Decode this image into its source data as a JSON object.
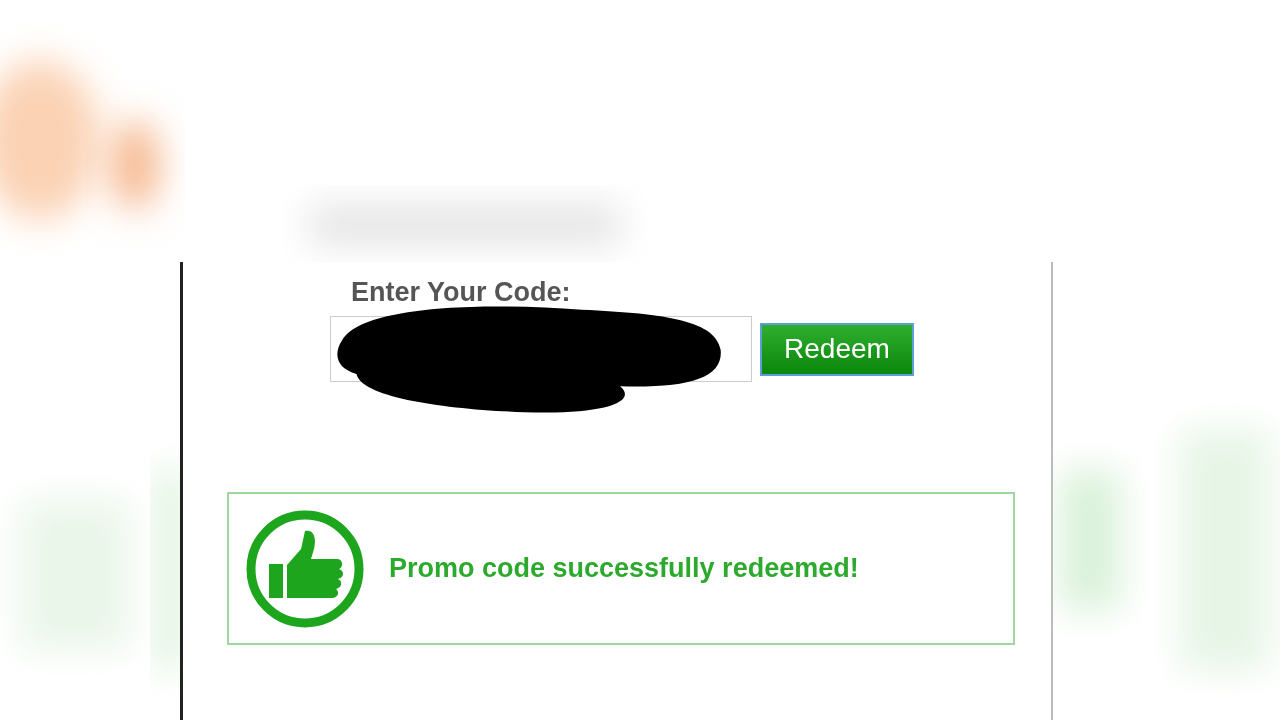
{
  "form": {
    "label": "Enter Your Code:",
    "redacted": true,
    "button": "Redeem"
  },
  "message": {
    "kind": "success",
    "text": "Promo code successfully redeemed!"
  }
}
